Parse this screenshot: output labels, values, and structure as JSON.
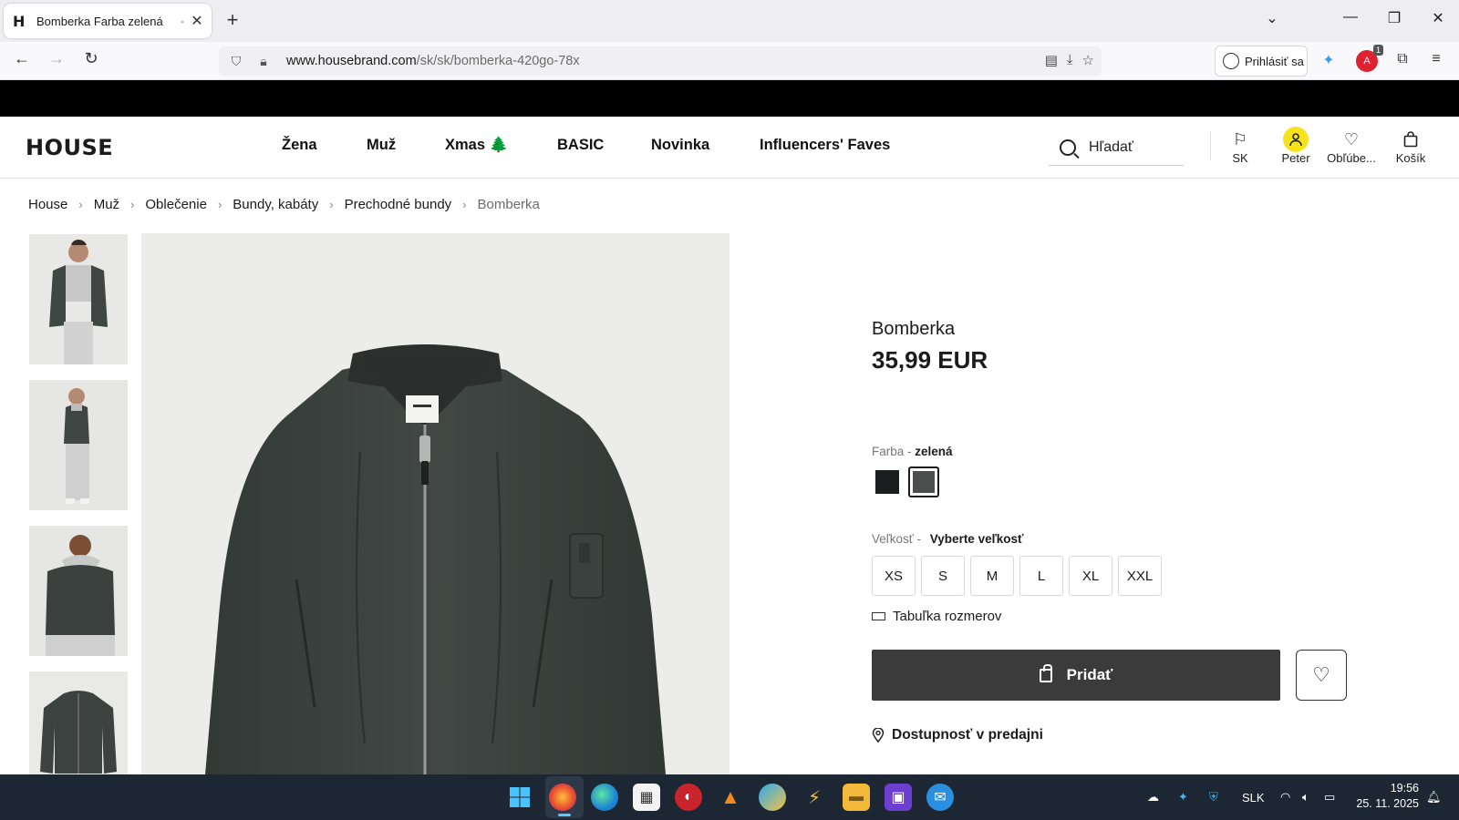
{
  "browser": {
    "tab_title": "Bomberka Farba zelená",
    "tab_favicon": "H",
    "tab_sep": "-",
    "url_host": "www.housebrand.com",
    "url_path": "/sk/sk/bomberka-420go-78x",
    "signin_label": "Prihlásiť sa",
    "ext_badge": "1"
  },
  "header": {
    "logo": "HOUSE",
    "nav": [
      "Žena",
      "Muž",
      "Xmas 🌲",
      "BASIC",
      "Novinka",
      "Influencers' Faves"
    ],
    "search_label": "Hľadať",
    "country": "SK",
    "user": "Peter",
    "favorites": "Obľúbe...",
    "cart": "Košík"
  },
  "breadcrumb": [
    "House",
    "Muž",
    "Oblečenie",
    "Bundy, kabáty",
    "Prechodné bundy",
    "Bomberka"
  ],
  "product": {
    "name": "Bomberka",
    "price": "35,99 EUR",
    "color_label": "Farba -",
    "color_value": "zelená",
    "swatches": [
      "#1c1d1f",
      "#4a4f4d"
    ],
    "size_label": "Veľkosť -",
    "size_prompt": "Vyberte veľkosť",
    "sizes": [
      "XS",
      "S",
      "M",
      "L",
      "XL",
      "XXL"
    ],
    "size_chart": "Tabuľka rozmerov",
    "add_label": "Pridať",
    "availability": "Dostupnosť v predajni"
  },
  "taskbar": {
    "lang": "SLK",
    "time": "19:56",
    "date": "25. 11. 2025"
  }
}
